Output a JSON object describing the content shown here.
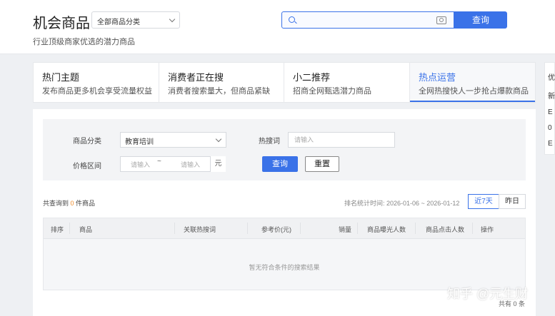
{
  "header": {
    "title": "机会商品",
    "subtitle": "行业顶级商家优选的潜力商品",
    "category_select": "全部商品分类",
    "search_placeholder": "",
    "search_button": "查询"
  },
  "tabs": [
    {
      "title": "热门主题",
      "desc": "发布商品更多机会享受流量权益",
      "active": false
    },
    {
      "title": "消费者正在搜",
      "desc": "消费者搜索量大，但商品紧缺",
      "active": false
    },
    {
      "title": "小二推荐",
      "desc": "招商全网甄选潜力商品",
      "active": false
    },
    {
      "title": "热点运营",
      "desc": "全网热搜快人一步抢占爆款商品",
      "active": true
    }
  ],
  "side_card": [
    "优",
    "新",
    "E",
    "0",
    "E"
  ],
  "filters": {
    "category_label": "商品分类",
    "category_value": "教育培训",
    "hot_word_label": "热搜词",
    "hot_word_placeholder": "请输入",
    "price_label": "价格区间",
    "price_min_placeholder": "请输入",
    "price_separator": "~",
    "price_max_placeholder": "请输入",
    "price_unit": "元",
    "query_button": "查询",
    "reset_button": "重置"
  },
  "results": {
    "prefix": "共查询到 ",
    "count": "0",
    "suffix": " 件商品",
    "stat_time": "排名统计时间: 2026-01-06 ~ 2026-01-12",
    "range_7d": "近7天",
    "range_yesterday": "昨日"
  },
  "table": {
    "columns": [
      "排序",
      "商品",
      "关联热搜词",
      "参考价(元)",
      "销量",
      "商品曝光人数",
      "商品点击人数",
      "操作"
    ],
    "rows": [],
    "empty_message": "暂无符合条件的搜索结果",
    "total": "共有 0 条"
  },
  "watermark": "知乎 @元生财",
  "colors": {
    "accent": "#3a72e8",
    "count": "#f08c28"
  }
}
